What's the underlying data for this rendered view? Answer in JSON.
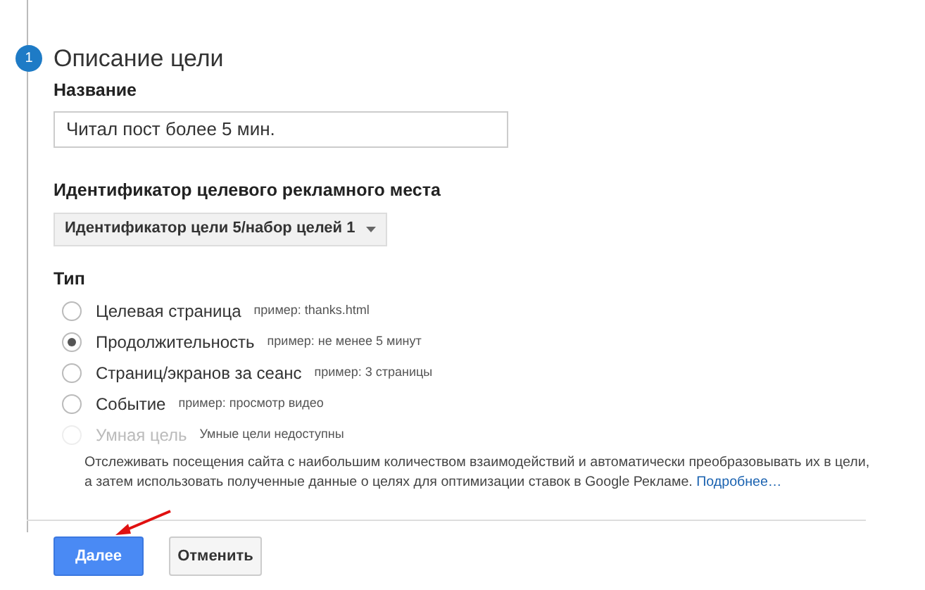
{
  "step": {
    "number": "1",
    "title": "Описание цели"
  },
  "name_field": {
    "label": "Название",
    "value": "Читал пост более 5 мин."
  },
  "slot": {
    "label": "Идентификатор целевого рекламного места",
    "dropdown": "Идентификатор цели 5/набор целей 1"
  },
  "type": {
    "label": "Тип",
    "options": [
      {
        "label": "Целевая страница",
        "hint": "пример: thanks.html",
        "selected": false,
        "disabled": false
      },
      {
        "label": "Продолжительность",
        "hint": "пример: не менее 5 минут",
        "selected": true,
        "disabled": false
      },
      {
        "label": "Страниц/экранов за сеанс",
        "hint": "пример: 3 страницы",
        "selected": false,
        "disabled": false
      },
      {
        "label": "Событие",
        "hint": "пример: просмотр видео",
        "selected": false,
        "disabled": false
      },
      {
        "label": "Умная цель",
        "hint": "Умные цели недоступны",
        "selected": false,
        "disabled": true
      }
    ],
    "description": "Отслеживать посещения сайта с наибольшим количеством взаимодействий и автоматически преобразовывать их в цели, а затем использовать полученные данные о целях для оптимизации ставок в Google Рекламе.",
    "link": "Подробнее…"
  },
  "buttons": {
    "next": "Далее",
    "cancel": "Отменить"
  }
}
